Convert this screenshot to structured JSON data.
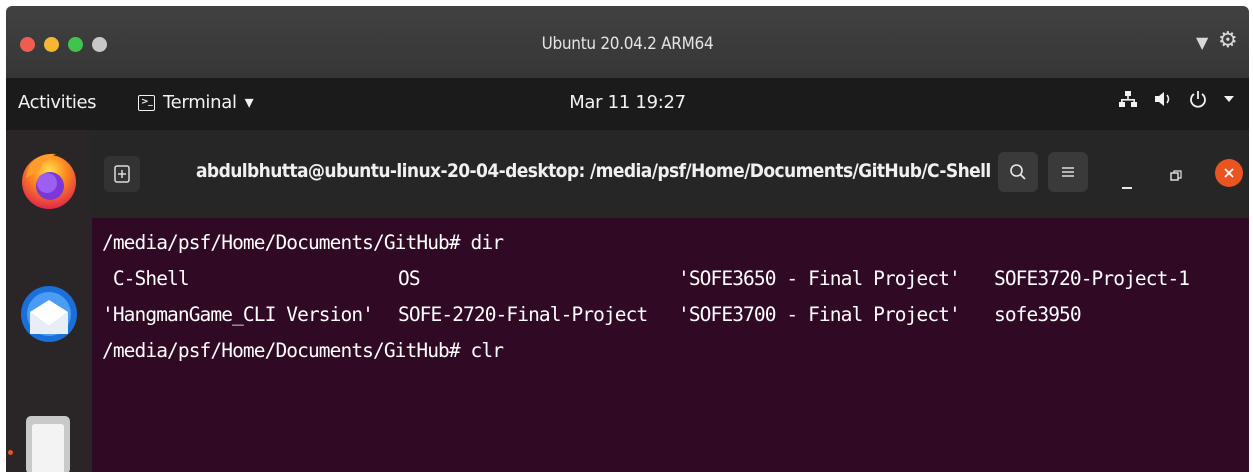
{
  "vm_window": {
    "title": "Ubuntu 20.04.2 ARM64",
    "traffic_lights": [
      "#ee5d4f",
      "#f5b731",
      "#3fc54d",
      "#c8c8c8"
    ],
    "controls": {
      "dropdown_glyph": "▼",
      "settings_glyph": "⚙"
    }
  },
  "topbar": {
    "activities": "Activities",
    "app_menu": "Terminal",
    "app_menu_arrow": "▾",
    "clock": "Mar 11  19:27",
    "tray_icons": [
      "network-icon",
      "volume-icon",
      "power-icon",
      "chevron-down-icon"
    ]
  },
  "dock": {
    "items": [
      "firefox-icon",
      "thunderbird-icon",
      "files-icon"
    ]
  },
  "terminal": {
    "title": "abdulbhutta@ubuntu-linux-20-04-desktop: /media/psf/Home/Documents/GitHub/C-Shell",
    "background": "#300a24",
    "accent": "#e95420",
    "lines": {
      "prompt1": "/media/psf/Home/Documents/GitHub# dir",
      "row1": [
        " C-Shell",
        "OS",
        "'SOFE3650 - Final Project'",
        "SOFE3720-Project-1"
      ],
      "row2": [
        "'HangmanGame_CLI Version'",
        "SOFE-2720-Final-Project",
        "'SOFE3700 - Final Project'",
        "sofe3950"
      ],
      "prompt2": "/media/psf/Home/Documents/GitHub# clr"
    }
  }
}
